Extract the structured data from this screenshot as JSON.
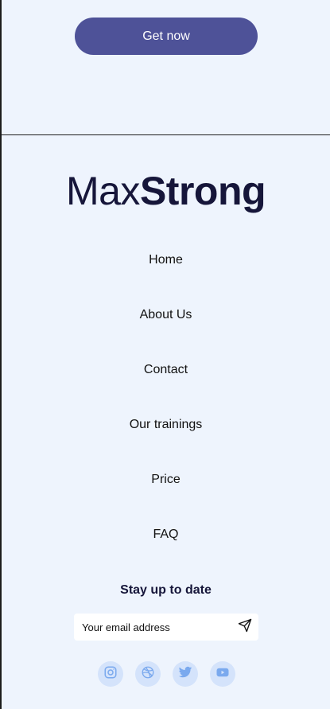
{
  "cta": {
    "button_label": "Get now"
  },
  "footer": {
    "logo": {
      "light_part": "Max",
      "bold_part": "Strong"
    },
    "nav": [
      {
        "label": "Home"
      },
      {
        "label": "About Us"
      },
      {
        "label": "Contact"
      },
      {
        "label": "Our trainings"
      },
      {
        "label": "Price"
      },
      {
        "label": "FAQ"
      }
    ],
    "newsletter": {
      "title": "Stay up to date",
      "email_placeholder": "Your email address",
      "send_icon": "send-icon"
    },
    "socials": [
      {
        "icon": "instagram-icon"
      },
      {
        "icon": "dribbble-icon"
      },
      {
        "icon": "twitter-icon"
      },
      {
        "icon": "youtube-icon"
      }
    ]
  },
  "colors": {
    "background": "#eef4fd",
    "accent": "#4e5298",
    "logo": "#16163a",
    "social_bg": "#d4e3fb",
    "social_icon": "#7aa9ee"
  }
}
